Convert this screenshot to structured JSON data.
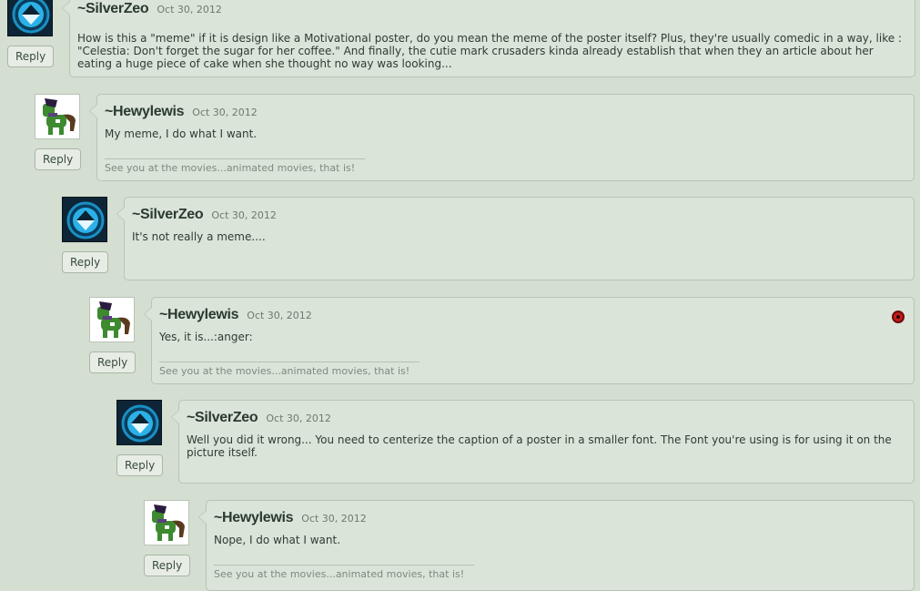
{
  "comments": [
    {
      "username": "~SilverZeo",
      "date": "Oct 30, 2012",
      "body": "How is this a \"meme\" if it is design like a Motivational poster, do you mean the meme of the poster itself? Plus, they're usually comedic in a way, like : \"Celestia: Don't forget the sugar for her coffee.\" And finally, the cutie mark crusaders kinda already establish that when they an article about her eating a huge piece of cake when she thought no way was looking...",
      "reply_label": "Reply",
      "avatar": "silverzeo-avatar"
    },
    {
      "username": "~Hewylewis",
      "date": "Oct 30, 2012",
      "body": "My meme, I do what I want.",
      "signature": "See you at the movies...animated movies, that is!",
      "reply_label": "Reply",
      "avatar": "hewylewis-pony-avatar"
    },
    {
      "username": "~SilverZeo",
      "date": "Oct 30, 2012",
      "body": "It's not really a meme....",
      "reply_label": "Reply",
      "avatar": "silverzeo-avatar"
    },
    {
      "username": "~Hewylewis",
      "date": "Oct 30, 2012",
      "body": "Yes, it is...:anger:",
      "signature": "See you at the movies...animated movies, that is!",
      "reply_label": "Reply",
      "avatar": "hewylewis-pony-avatar",
      "flag_icon": "red-dot-icon"
    },
    {
      "username": "~SilverZeo",
      "date": "Oct 30, 2012",
      "body": "Well you did it wrong... You need to centerize the caption of a poster in a smaller font. The Font you're using is for using it on the picture itself.",
      "reply_label": "Reply",
      "avatar": "silverzeo-avatar"
    },
    {
      "username": "~Hewylewis",
      "date": "Oct 30, 2012",
      "body": "Nope, I do what I want.",
      "signature": "See you at the movies...animated movies, that is!",
      "reply_label": "Reply",
      "avatar": "hewylewis-pony-avatar"
    }
  ]
}
